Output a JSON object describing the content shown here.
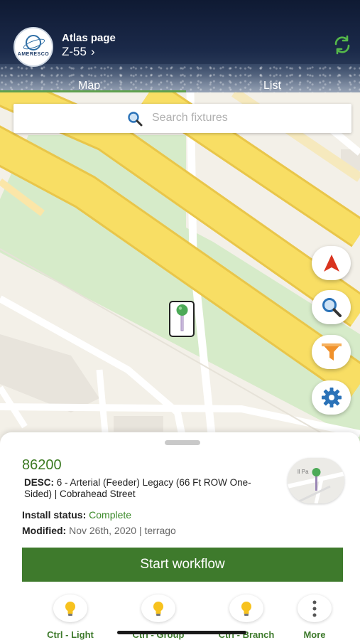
{
  "header": {
    "logo_text": "AMERESCO",
    "title": "Atlas page",
    "subtitle": "Z-55",
    "subtitle_chevron": "›",
    "sync_icon": "sync-icon",
    "tabs": [
      {
        "label": "Map",
        "active": true
      },
      {
        "label": "List",
        "active": false
      }
    ]
  },
  "search": {
    "placeholder": "Search fixtures",
    "icon": "search-icon"
  },
  "map_controls": [
    {
      "name": "location-arrow-icon",
      "color": "#d9341f"
    },
    {
      "name": "zoom-search-icon",
      "color": "#2a72b8"
    },
    {
      "name": "filter-icon",
      "color": "#f0912b"
    },
    {
      "name": "settings-icon",
      "color": "#2a72b8"
    }
  ],
  "colors": {
    "accent_green": "#3e7a2c",
    "road_yellow": "#f7dc62",
    "park_green": "#d4e8c6",
    "map_base": "#f3f0e8"
  },
  "fixture": {
    "id": "86200",
    "desc_label": "DESC:",
    "desc_value": "6 - Arterial (Feeder) Legacy (66 Ft ROW One-Sided) | Cobrahead Street",
    "install_label": "Install status:",
    "install_value": "Complete",
    "modified_label": "Modified:",
    "modified_value": "Nov 26th, 2020 | terrago",
    "thumbnail_text": "ll Pa"
  },
  "workflow_button": "Start workflow",
  "bottom_nav": [
    {
      "label": "Ctrl - Light",
      "icon": "lightbulb-icon"
    },
    {
      "label": "Ctrl - Group",
      "icon": "lightbulb-icon"
    },
    {
      "label": "Ctrl - Branch",
      "icon": "lightbulb-icon"
    },
    {
      "label": "More",
      "icon": "more-vertical-icon"
    }
  ]
}
